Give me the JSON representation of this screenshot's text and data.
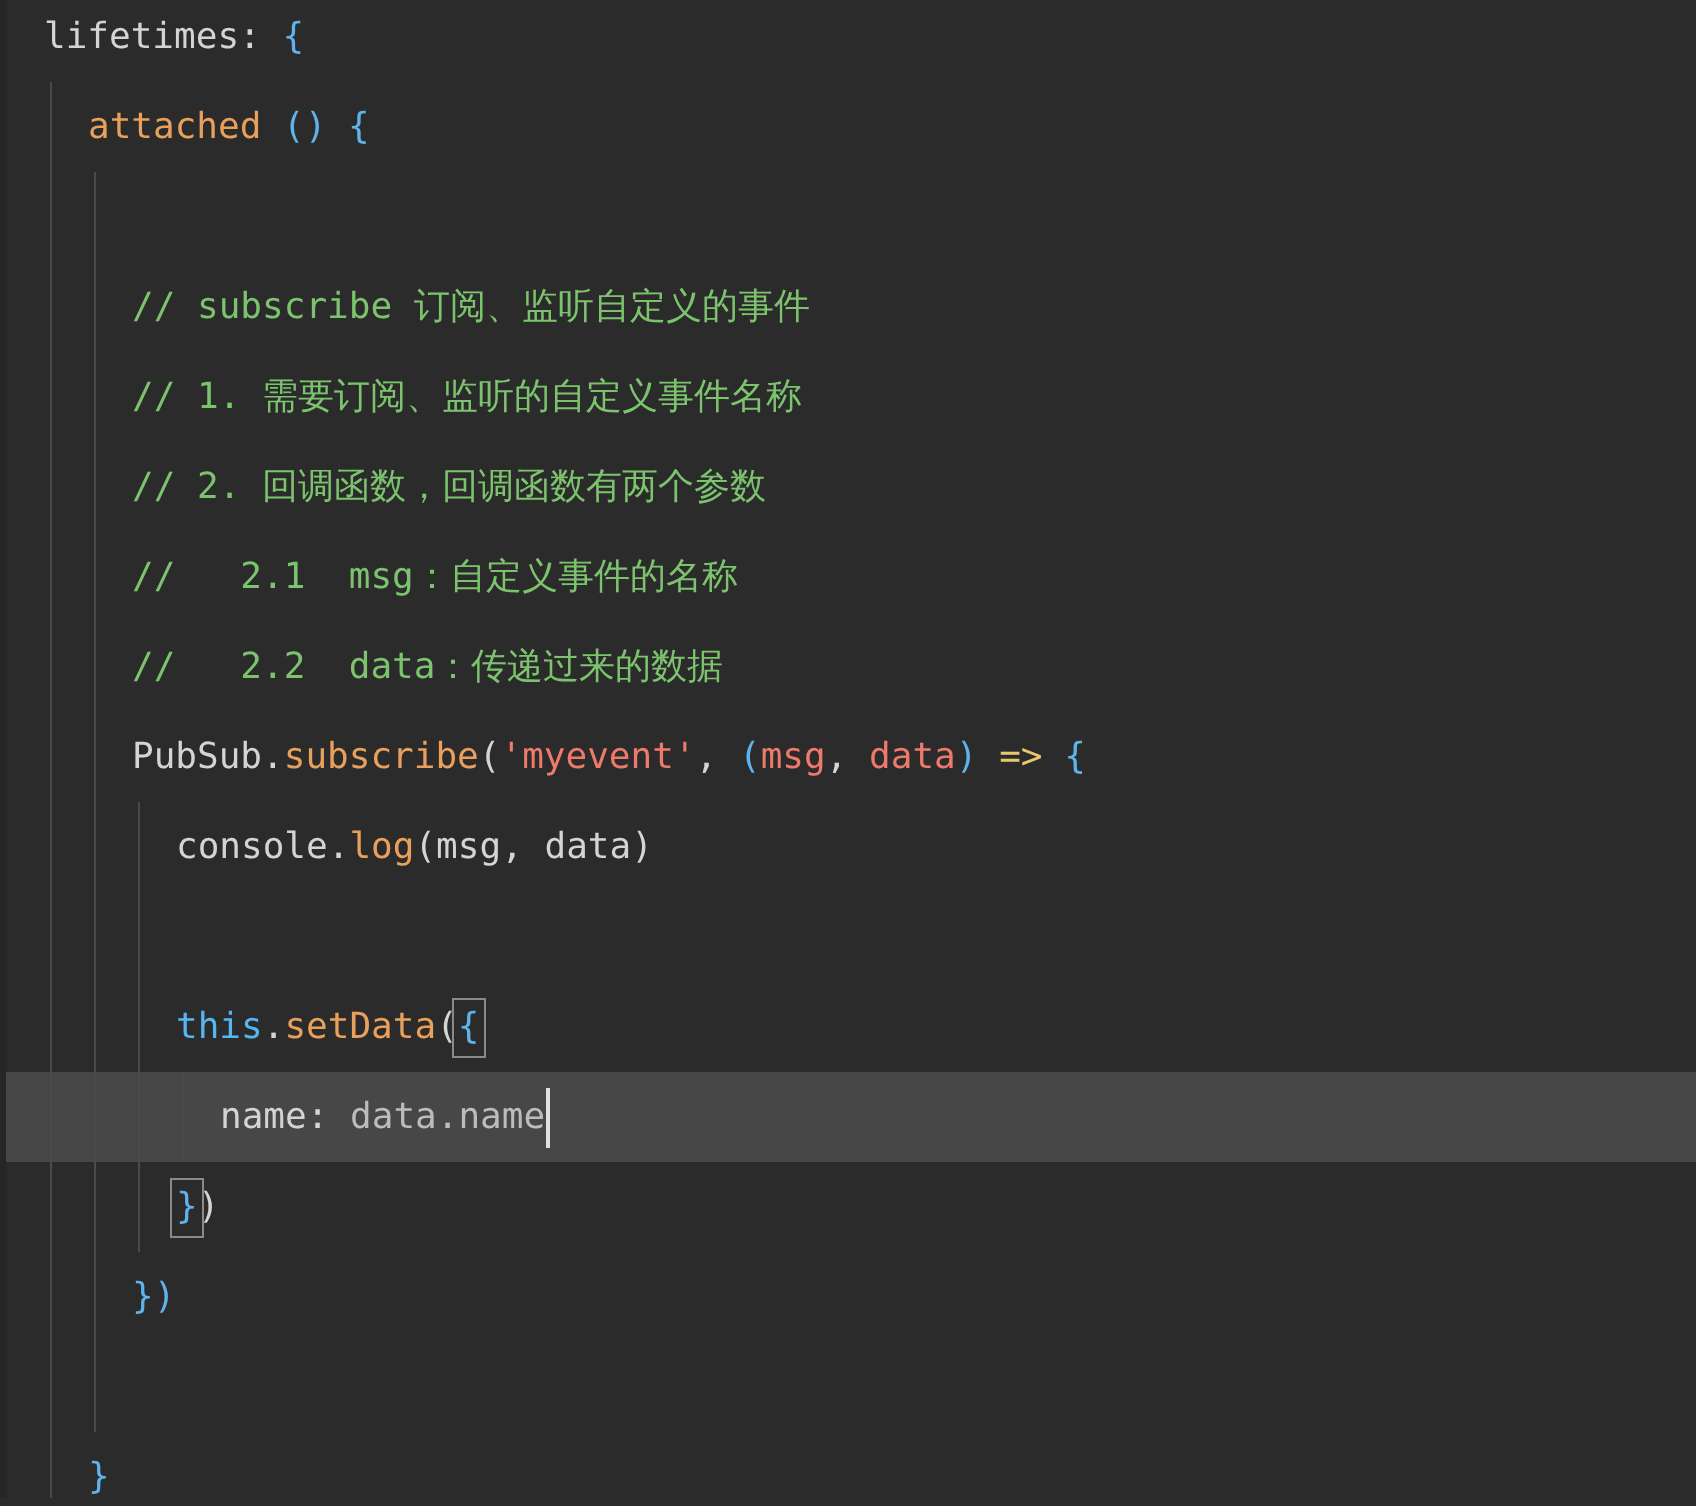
{
  "editor": {
    "lines": [
      {
        "selected": false,
        "tokens": [
          {
            "text": "lifetimes: ",
            "kind": "plain"
          },
          {
            "text": "{",
            "kind": "brace"
          }
        ],
        "children": [
          {
            "selected": false,
            "tokens": [
              {
                "text": "attached",
                "kind": "func"
              },
              {
                "text": " () {",
                "kind": "brace"
              }
            ],
            "children": [
              {
                "selected": false
              },
              {
                "selected": false,
                "tokens": [
                  {
                    "text": "// subscribe 订阅、监听自定义的事件",
                    "kind": "comment"
                  }
                ]
              },
              {
                "selected": false,
                "tokens": [
                  {
                    "text": "// 1. 需要订阅、监听的自定义事件名称",
                    "kind": "comment"
                  }
                ]
              },
              {
                "selected": false,
                "tokens": [
                  {
                    "text": "// 2. 回调函数，回调函数有两个参数",
                    "kind": "comment"
                  }
                ]
              },
              {
                "selected": false,
                "tokens": [
                  {
                    "text": "//   2.1  msg：自定义事件的名称",
                    "kind": "comment"
                  }
                ]
              },
              {
                "selected": false,
                "tokens": [
                  {
                    "text": "//   2.2  data：传递过来的数据",
                    "kind": "comment"
                  }
                ]
              },
              {
                "selected": false,
                "tokens": [
                  {
                    "text": "PubSub.",
                    "kind": "plain"
                  },
                  {
                    "text": "subscribe",
                    "kind": "func"
                  },
                  {
                    "text": "(",
                    "kind": "plain"
                  },
                  {
                    "text": "'myevent'",
                    "kind": "string"
                  },
                  {
                    "text": ", ",
                    "kind": "plain"
                  },
                  {
                    "text": "(",
                    "kind": "brace"
                  },
                  {
                    "text": "msg",
                    "kind": "param"
                  },
                  {
                    "text": ", ",
                    "kind": "plain"
                  },
                  {
                    "text": "data",
                    "kind": "param"
                  },
                  {
                    "text": ")",
                    "kind": "brace"
                  },
                  {
                    "text": " =>",
                    "kind": "arrow"
                  },
                  {
                    "text": " {",
                    "kind": "brace"
                  }
                ],
                "children": [
                  {
                    "selected": false,
                    "tokens": [
                      {
                        "text": "console.",
                        "kind": "plain"
                      },
                      {
                        "text": "log",
                        "kind": "func"
                      },
                      {
                        "text": "(msg, data)",
                        "kind": "plain"
                      }
                    ]
                  },
                  {
                    "selected": false
                  },
                  {
                    "selected": false,
                    "tokens": [
                      {
                        "text": "this",
                        "kind": "keyword"
                      },
                      {
                        "text": ".",
                        "kind": "plain"
                      },
                      {
                        "text": "setData",
                        "kind": "func"
                      },
                      {
                        "text": "(",
                        "kind": "plain"
                      },
                      {
                        "text": "{",
                        "kind": "brace",
                        "matched": true
                      }
                    ],
                    "children": [
                      {
                        "selected": true,
                        "tokens": [
                          {
                            "text": "name: ",
                            "kind": "plain"
                          },
                          {
                            "text": "data.name",
                            "kind": "variable"
                          }
                        ]
                      }
                    ]
                  },
                  {
                    "selected": false,
                    "tokens": [
                      {
                        "text": "}",
                        "kind": "brace",
                        "matched": true
                      },
                      {
                        "text": ")",
                        "kind": "plain"
                      }
                    ]
                  }
                ]
              },
              {
                "selected": false,
                "tokens": [
                  {
                    "text": "})",
                    "kind": "brace"
                  }
                ]
              },
              {
                "selected": false
              }
            ]
          },
          {
            "selected": false,
            "tokens": [
              {
                "text": "}",
                "kind": "brace"
              }
            ]
          }
        ]
      }
    ]
  }
}
